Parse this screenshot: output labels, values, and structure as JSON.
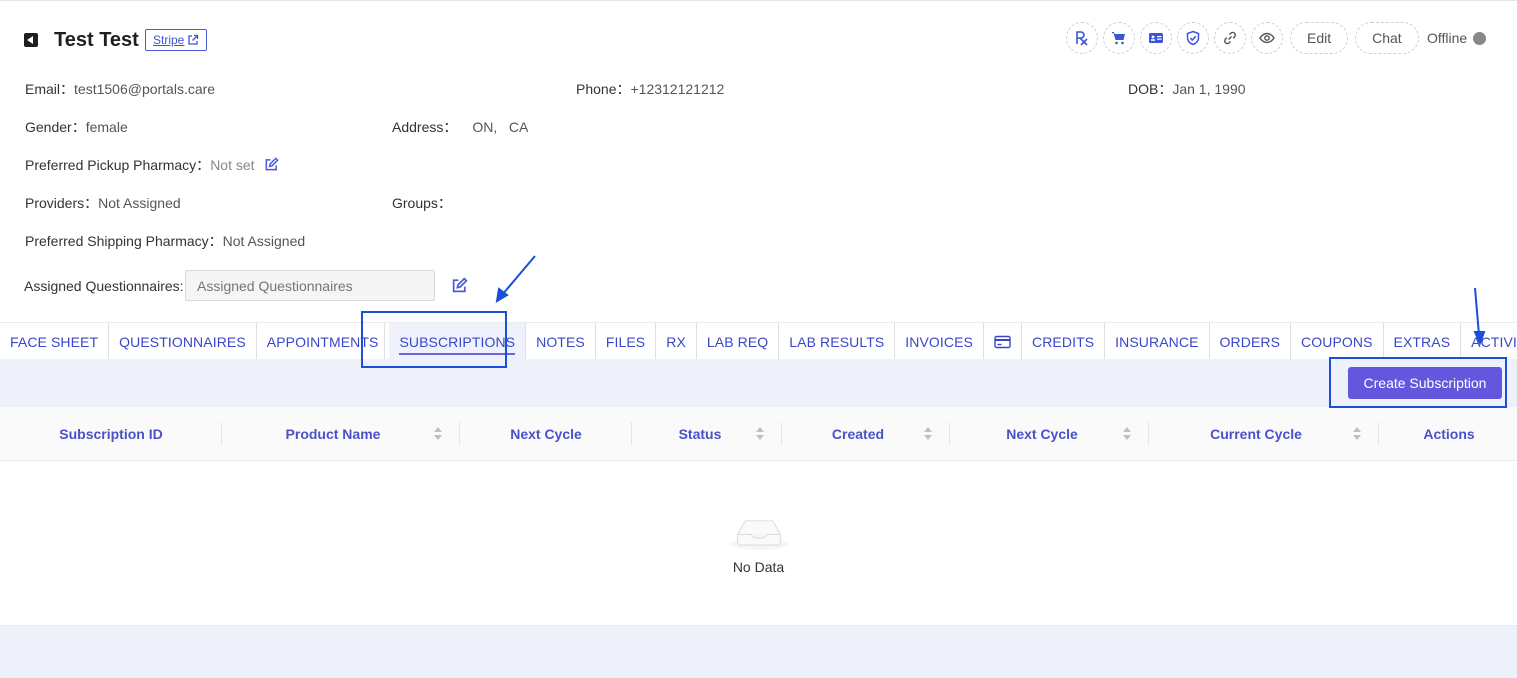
{
  "header": {
    "patient_name": "Test Test",
    "stripe_label": "Stripe",
    "edit_label": "Edit",
    "chat_label": "Chat",
    "status_label": "Offline"
  },
  "info": {
    "email_label": "Email：",
    "email_value": "test1506@portals.care",
    "phone_label": "Phone：",
    "phone_value": "+12312121212",
    "dob_label": "DOB：",
    "dob_value": "Jan 1, 1990",
    "gender_label": "Gender：",
    "gender_value": "female",
    "address_label": "Address：",
    "address_value": "ON,   CA",
    "pickup_label": "Preferred Pickup Pharmacy：",
    "pickup_value": "Not set",
    "providers_label": "Providers：",
    "providers_value": "Not Assigned",
    "groups_label": "Groups：",
    "shipping_label": "Preferred Shipping Pharmacy：",
    "shipping_value": "Not Assigned",
    "questionnaires_label": "Assigned Questionnaires:",
    "questionnaires_placeholder": "Assigned Questionnaires"
  },
  "tabs": [
    {
      "label": "FACE SHEET"
    },
    {
      "label": "QUESTIONNAIRES"
    },
    {
      "label": "APPOINTMENTS"
    },
    {
      "label": "SUBSCRIPTIONS"
    },
    {
      "label": "NOTES"
    },
    {
      "label": "FILES"
    },
    {
      "label": "RX"
    },
    {
      "label": "LAB REQ"
    },
    {
      "label": "LAB RESULTS"
    },
    {
      "label": "INVOICES"
    },
    {
      "label": "",
      "icon": "credit-card-icon"
    },
    {
      "label": "CREDITS"
    },
    {
      "label": "INSURANCE"
    },
    {
      "label": "ORDERS"
    },
    {
      "label": "COUPONS"
    },
    {
      "label": "EXTRAS"
    },
    {
      "label": "ACTIVITY"
    }
  ],
  "active_tab": "SUBSCRIPTIONS",
  "toolbar": {
    "create_label": "Create Subscription"
  },
  "table": {
    "columns": [
      {
        "label": "Subscription ID"
      },
      {
        "label": "Product Name"
      },
      {
        "label": "Next Cycle"
      },
      {
        "label": "Status"
      },
      {
        "label": "Created"
      },
      {
        "label": "Next Cycle"
      },
      {
        "label": "Current Cycle"
      },
      {
        "label": "Actions"
      }
    ],
    "empty_text": "No Data"
  },
  "colors": {
    "accent": "#6358dd",
    "tab_text": "#3a46c8",
    "annotation": "#1a4fd8",
    "band": "#eef1fa"
  },
  "icons": [
    "back-icon",
    "external-link-icon",
    "rx-icon",
    "cart-icon",
    "id-card-icon",
    "shield-icon",
    "link-icon",
    "eye-icon",
    "edit-icon",
    "credit-card-icon",
    "sort-icon",
    "empty-inbox-icon"
  ]
}
